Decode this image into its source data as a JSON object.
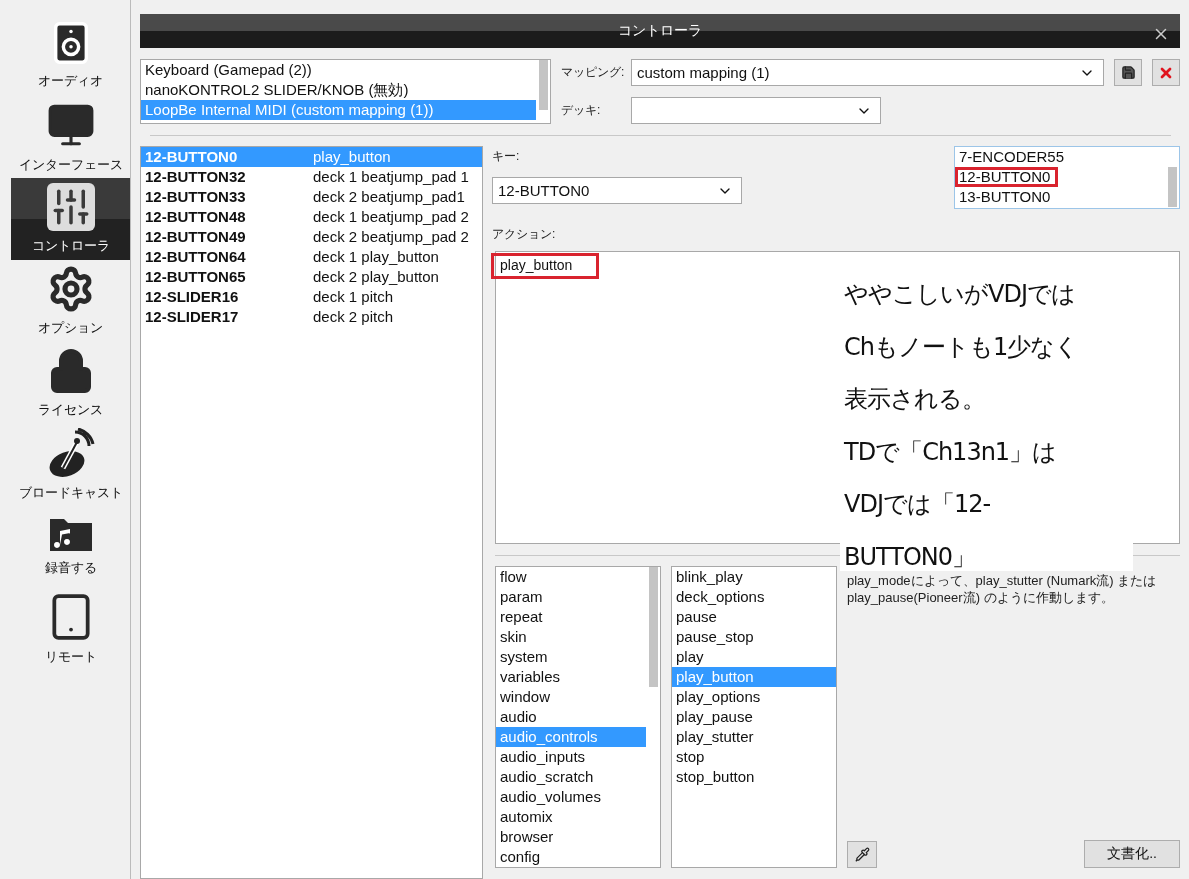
{
  "sidebar": {
    "items": [
      {
        "label": "オーディオ",
        "kind": "speaker",
        "selected": false
      },
      {
        "label": "インターフェース",
        "kind": "monitor",
        "selected": false
      },
      {
        "label": "コントローラ",
        "kind": "sliders",
        "selected": true
      },
      {
        "label": "オプション",
        "kind": "gear",
        "selected": false
      },
      {
        "label": "ライセンス",
        "kind": "lock",
        "selected": false
      },
      {
        "label": "ブロードキャスト",
        "kind": "dish",
        "selected": false
      },
      {
        "label": "録音する",
        "kind": "folder",
        "selected": false
      },
      {
        "label": "リモート",
        "kind": "tablet",
        "selected": false
      }
    ]
  },
  "dialog": {
    "title": "コントローラ"
  },
  "devices": [
    {
      "label": "Keyboard (Gamepad (2))",
      "selected": false
    },
    {
      "label": "nanoKONTROL2 SLIDER/KNOB (無効)",
      "selected": false
    },
    {
      "label": "LoopBe Internal MIDI (custom mapping (1))",
      "selected": true
    }
  ],
  "mapping": {
    "label": "マッピング:",
    "value": "custom mapping (1)"
  },
  "deck": {
    "label": "デッキ:"
  },
  "mappings": [
    {
      "key": "12-BUTTON0",
      "action": "play_button",
      "selected": true
    },
    {
      "key": "12-BUTTON32",
      "action": "deck 1 beatjump_pad 1",
      "selected": false
    },
    {
      "key": "12-BUTTON33",
      "action": "deck 2 beatjump_pad1",
      "selected": false
    },
    {
      "key": "12-BUTTON48",
      "action": "deck 1 beatjump_pad 2",
      "selected": false
    },
    {
      "key": "12-BUTTON49",
      "action": "deck 2 beatjump_pad 2",
      "selected": false
    },
    {
      "key": "12-BUTTON64",
      "action": "deck 1 play_button",
      "selected": false
    },
    {
      "key": "12-BUTTON65",
      "action": "deck 2 play_button",
      "selected": false
    },
    {
      "key": "12-SLIDER16",
      "action": "deck 1 pitch",
      "selected": false
    },
    {
      "key": "12-SLIDER17",
      "action": "deck 2 pitch",
      "selected": false
    }
  ],
  "key": {
    "label": "キー:",
    "value": "12-BUTTON0"
  },
  "key_list": [
    {
      "label": "7-ENCODER55",
      "highlighted": false
    },
    {
      "label": "12-BUTTON0",
      "highlighted": true
    },
    {
      "label": "13-BUTTON0",
      "highlighted": false
    }
  ],
  "action": {
    "label": "アクション:",
    "value": "play_button",
    "highlighted": true
  },
  "categories": [
    {
      "label": "flow",
      "selected": false
    },
    {
      "label": "param",
      "selected": false
    },
    {
      "label": "repeat",
      "selected": false
    },
    {
      "label": "skin",
      "selected": false
    },
    {
      "label": "system",
      "selected": false
    },
    {
      "label": "variables",
      "selected": false
    },
    {
      "label": "window",
      "selected": false
    },
    {
      "label": "audio",
      "selected": false
    },
    {
      "label": "audio_controls",
      "selected": true
    },
    {
      "label": "audio_inputs",
      "selected": false
    },
    {
      "label": "audio_scratch",
      "selected": false
    },
    {
      "label": "audio_volumes",
      "selected": false
    },
    {
      "label": "automix",
      "selected": false
    },
    {
      "label": "browser",
      "selected": false
    },
    {
      "label": "config",
      "selected": false
    }
  ],
  "verbs": [
    {
      "label": "blink_play",
      "selected": false
    },
    {
      "label": "deck_options",
      "selected": false
    },
    {
      "label": "pause",
      "selected": false
    },
    {
      "label": "pause_stop",
      "selected": false
    },
    {
      "label": "play",
      "selected": false
    },
    {
      "label": "play_button",
      "selected": true
    },
    {
      "label": "play_options",
      "selected": false
    },
    {
      "label": "play_pause",
      "selected": false
    },
    {
      "label": "play_stutter",
      "selected": false
    },
    {
      "label": "stop",
      "selected": false
    },
    {
      "label": "stop_button",
      "selected": false
    }
  ],
  "description": "play_modeによって、play_stutter (Numark流) またはplay_pause(Pioneer流) のように作動します。",
  "document_button": "文書化..",
  "annotation": {
    "lines": [
      "ややこしいがVDJでは",
      "Chもノートも1少なく",
      "表示される。",
      "TDで「Ch13n1」は",
      "VDJでは「12-",
      "BUTTON0」"
    ]
  }
}
